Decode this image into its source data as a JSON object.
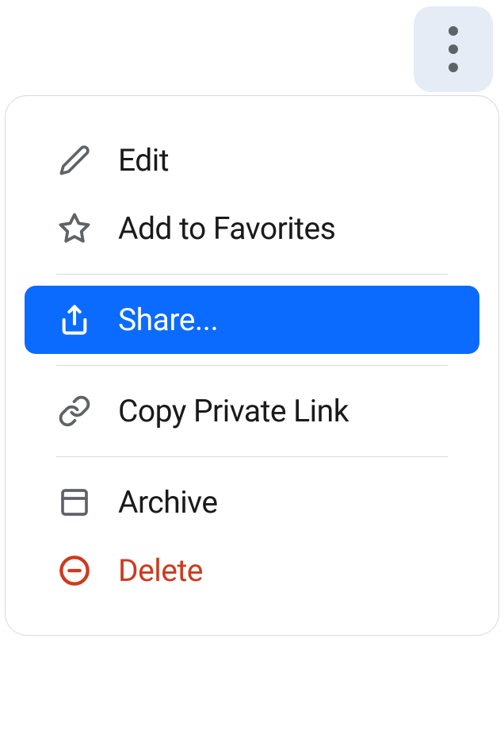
{
  "menu": {
    "items": [
      {
        "label": "Edit",
        "icon": "pencil-icon"
      },
      {
        "label": "Add to Favorites",
        "icon": "star-icon"
      },
      {
        "label": "Share...",
        "icon": "share-icon",
        "highlighted": true
      },
      {
        "label": "Copy Private Link",
        "icon": "link-icon"
      },
      {
        "label": "Archive",
        "icon": "archive-icon"
      },
      {
        "label": "Delete",
        "icon": "minus-circle-icon",
        "danger": true
      }
    ]
  },
  "colors": {
    "highlight": "#0b6bff",
    "danger": "#cc3b1f",
    "iconDefault": "#5f6368"
  }
}
